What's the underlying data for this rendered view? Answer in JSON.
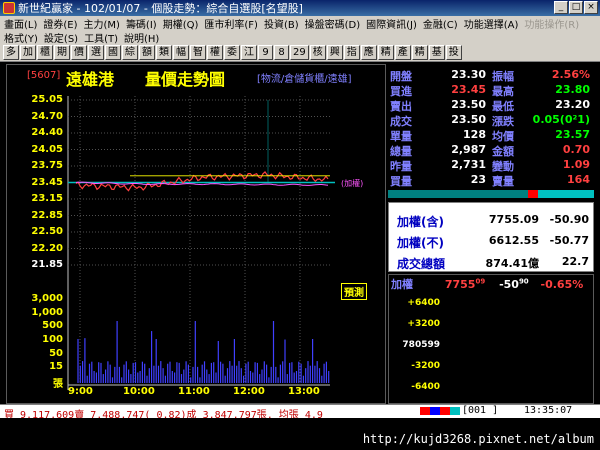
{
  "window": {
    "title": "新世紀贏家 - 102/01/07 - 個股走勢：綜合自選股[名望股]"
  },
  "menu": {
    "row1": [
      "畫面(L)",
      "證券(E)",
      "主力(M)",
      "籌碼(I)",
      "期權(Q)",
      "匯市利率(F)",
      "投資(B)",
      "操盤密碼(D)",
      "國際資訊(J)",
      "金融(C)",
      "功能選擇(A)",
      "功能操作(R)"
    ],
    "row2": [
      "格式(Y)",
      "設定(S)",
      "工具(T)",
      "說明(H)"
    ]
  },
  "toolbar": [
    "多",
    "加",
    "櫃",
    "期",
    "價",
    "選",
    "國",
    "綜",
    "額",
    "類",
    "幅",
    "智",
    "權",
    "委",
    "江",
    "9",
    "8",
    "29",
    "核",
    "興",
    "指",
    "應",
    "精",
    "產",
    "精",
    "基",
    "投"
  ],
  "stock": {
    "code": "[5607]",
    "name": "遠雄港",
    "chart_title": "量價走勢圖",
    "category": "[物流/倉儲貨櫃/遠雄]"
  },
  "price_axis": [
    "25.05",
    "24.70",
    "24.40",
    "24.05",
    "23.75",
    "23.45",
    "23.15",
    "22.85",
    "22.50",
    "22.20",
    "21.85"
  ],
  "volume_axis": [
    "3,000",
    "1,000",
    "500",
    "100",
    "50",
    "15",
    "張"
  ],
  "time_axis": [
    "9:00",
    "10:00",
    "11:00",
    "12:00",
    "13:00"
  ],
  "weighted_tag": "(加權)",
  "pred_badge": "預測",
  "quote": {
    "left": [
      {
        "label": "開盤",
        "value": "23.30"
      },
      {
        "label": "買進",
        "value": "23.45"
      },
      {
        "label": "賣出",
        "value": "23.50"
      },
      {
        "label": "成交",
        "value": "23.50"
      },
      {
        "label": "單量",
        "value": "128"
      },
      {
        "label": "總量",
        "value": "2,987"
      },
      {
        "label": "昨量",
        "value": "2,731"
      },
      {
        "label": "買量",
        "value": "23"
      }
    ],
    "right": [
      {
        "label": "振幅",
        "value": "2.56%",
        "color": "#ff4040"
      },
      {
        "label": "最高",
        "value": "23.80",
        "color": "#00ff00"
      },
      {
        "label": "最低",
        "value": "23.20",
        "color": "#ffffff"
      },
      {
        "label": "漲跌",
        "value": "0.05(0²1)",
        "color": "#00ff00"
      },
      {
        "label": "均價",
        "value": "23.57",
        "color": "#00ff00"
      },
      {
        "label": "金額",
        "value": "0.70",
        "color": "#ff4040"
      },
      {
        "label": "變動",
        "value": "1.09",
        "color": "#ff4040"
      },
      {
        "label": "賣量",
        "value": "164",
        "color": "#ff4040"
      }
    ]
  },
  "index_panel": [
    {
      "label": "加權(含)",
      "value": "7755.09",
      "change": "-50.90"
    },
    {
      "label": "加權(不)",
      "value": "6612.55",
      "change": "-50.77"
    },
    {
      "label": "成交總額",
      "value": "874.41億",
      "change": "22.7"
    }
  ],
  "mini": {
    "label": "加權",
    "value": "7755",
    "value_sup": "09",
    "change": "-50",
    "change_sup": "90",
    "pct": "-0.65%",
    "axis": [
      "+6400",
      "+3200",
      "780599",
      "-3200",
      "-6400"
    ]
  },
  "status": {
    "text": "買 9,117,609賣 7,488,747( 0.82)成 3,847,797張, 均張 4.9",
    "code": "[001    ]",
    "time": "13:35:07"
  },
  "watermark": "http://kujd3268.pixnet.net/album",
  "chart_data": {
    "type": "line",
    "title": "量價走勢圖",
    "x": [
      "9:00",
      "10:00",
      "11:00",
      "12:00",
      "13:00"
    ],
    "ylim": [
      21.85,
      25.05
    ],
    "series": [
      {
        "name": "",
        "values": [
          23.4,
          23.35,
          23.55,
          23.6,
          23.5
        ]
      },
      {
        "name": "(加權)",
        "values": [
          23.45,
          23.42,
          23.42,
          23.41,
          23.4
        ]
      }
    ],
    "volume_axis": [
      "3,000",
      "1,000",
      "500",
      "100",
      "50",
      "15"
    ]
  }
}
